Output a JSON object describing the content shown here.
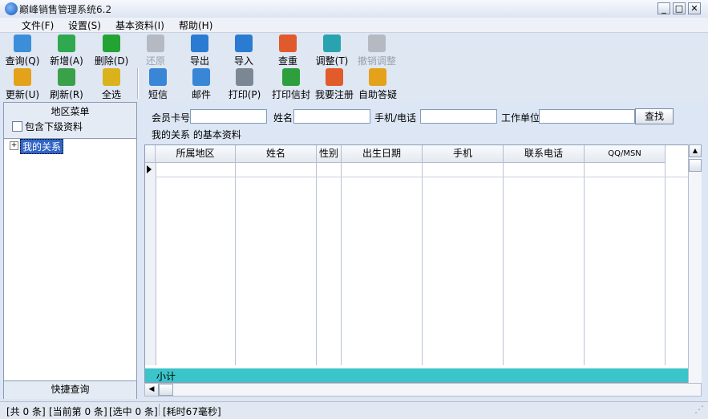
{
  "window": {
    "title": "巅峰销售管理系统6.2",
    "controls": {
      "minimize": "_",
      "maximize": "□",
      "close": "✕"
    }
  },
  "menu": [
    "文件(F)",
    "设置(S)",
    "基本资料(I)",
    "帮助(H)"
  ],
  "toolbar_row1": [
    {
      "label": "查询(Q)",
      "icon": "magnifier-icon",
      "color": "#3b8fd8",
      "enabled": true
    },
    {
      "label": "新增(A)",
      "icon": "add-record-icon",
      "color": "#2fa84f",
      "enabled": true
    },
    {
      "label": "删除(D)",
      "icon": "delete-x-icon",
      "color": "#23a334",
      "enabled": true
    },
    {
      "label": "还原",
      "icon": "restore-icon",
      "color": "#b5bac2",
      "enabled": false
    },
    {
      "label": "导出",
      "icon": "export-icon",
      "color": "#2a7bd1",
      "enabled": true
    },
    {
      "label": "导入",
      "icon": "import-icon",
      "color": "#2a7bd1",
      "enabled": true
    },
    {
      "label": "查重",
      "icon": "broom-icon",
      "color": "#e05a2b",
      "enabled": true
    },
    {
      "label": "调整(T)",
      "icon": "adjust-icon",
      "color": "#2aa3b0",
      "enabled": true
    },
    {
      "label": "撤销调整",
      "icon": "undo-adjust-icon",
      "color": "#b5bac2",
      "enabled": false
    }
  ],
  "toolbar_row2": [
    {
      "label": "更新(U)",
      "icon": "update-icon",
      "color": "#e3a21a",
      "enabled": true
    },
    {
      "label": "刷新(R)",
      "icon": "refresh-icon",
      "color": "#3aa04a",
      "enabled": true
    },
    {
      "label": "全选",
      "icon": "select-all-icon",
      "color": "#d9b21c",
      "enabled": true
    },
    {
      "label": "短信",
      "icon": "globe-icon",
      "color": "#3a86d6",
      "enabled": true
    },
    {
      "label": "邮件",
      "icon": "mail-icon",
      "color": "#3a86d6",
      "enabled": true
    },
    {
      "label": "打印(P)",
      "icon": "printer-icon",
      "color": "#7c8794",
      "enabled": true
    },
    {
      "label": "打印信封",
      "icon": "envelope-print-icon",
      "color": "#2e9f3d",
      "enabled": true
    },
    {
      "label": "我要注册",
      "icon": "windows-logo-icon",
      "color": "#e25b2b",
      "enabled": true
    },
    {
      "label": "自助答疑",
      "icon": "help-key-icon",
      "color": "#e3a21a",
      "enabled": true
    }
  ],
  "left_panel": {
    "title": "地区菜单",
    "checkbox_label": "包含下级资料",
    "checkbox_checked": false,
    "tree_expander": "+",
    "tree_root": "我的关系",
    "footer": "快捷查询"
  },
  "search": {
    "member_card_label": "会员卡号",
    "member_card_value": "",
    "name_label": "姓名",
    "name_value": "",
    "phone_label": "手机/电话",
    "phone_value": "",
    "company_label": "工作单位",
    "company_value": "",
    "find_button": "查找",
    "info_caption": "我的关系 的基本资料"
  },
  "grid": {
    "columns": [
      "所属地区",
      "姓名",
      "性别",
      "出生日期",
      "手机",
      "联系电话",
      "QQ/MSN"
    ],
    "rows": [],
    "subtotal_label": "小计"
  },
  "status": [
    "[共 0 条]",
    "[当前第 0 条]",
    "[选中 0 条]",
    "[耗时67毫秒]"
  ]
}
